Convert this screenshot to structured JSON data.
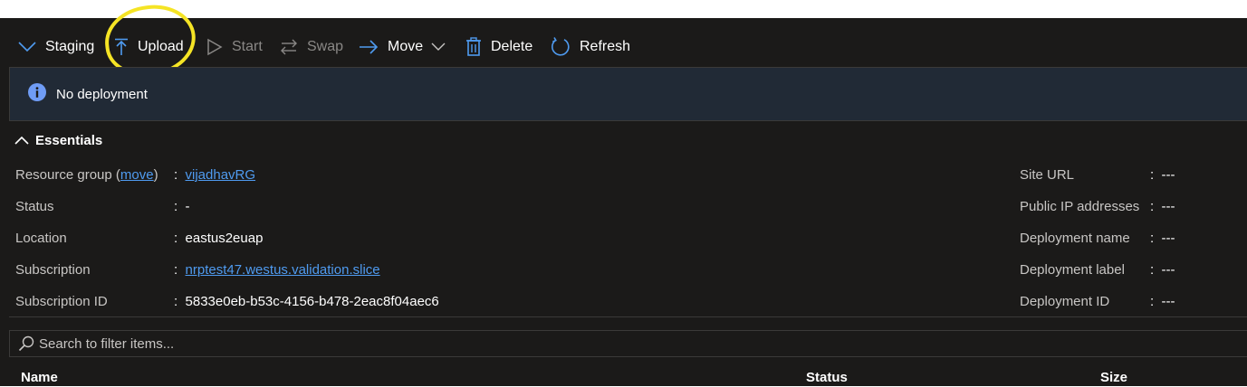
{
  "toolbar": {
    "staging_label": "Staging",
    "upload_label": "Upload",
    "start_label": "Start",
    "swap_label": "Swap",
    "move_label": "Move",
    "delete_label": "Delete",
    "refresh_label": "Refresh"
  },
  "infobar": {
    "message": "No deployment"
  },
  "essentials": {
    "title": "Essentials",
    "left": {
      "resource_group_label": "Resource group",
      "move_link": "move",
      "resource_group_value": "vijadhavRG",
      "status_label": "Status",
      "status_value": "-",
      "location_label": "Location",
      "location_value": "eastus2euap",
      "subscription_label": "Subscription",
      "subscription_value": "nrptest47.westus.validation.slice",
      "subscription_id_label": "Subscription ID",
      "subscription_id_value": "5833e0eb-b53c-4156-b478-2eac8f04aec6"
    },
    "right": {
      "site_url_label": "Site URL",
      "site_url_value": "---",
      "public_ip_label": "Public IP addresses",
      "public_ip_value": "---",
      "deployment_name_label": "Deployment name",
      "deployment_name_value": "---",
      "deployment_label_label": "Deployment label",
      "deployment_label_value": "---",
      "deployment_id_label": "Deployment ID",
      "deployment_id_value": "---"
    },
    "separator": ":"
  },
  "search": {
    "placeholder": "Search to filter items..."
  },
  "table": {
    "columns": [
      "Name",
      "Status",
      "Size"
    ]
  },
  "colors": {
    "background": "#1b1a19",
    "accent": "#4f9bf0",
    "highlight": "#f5e425",
    "info_bar": "#212a36"
  }
}
